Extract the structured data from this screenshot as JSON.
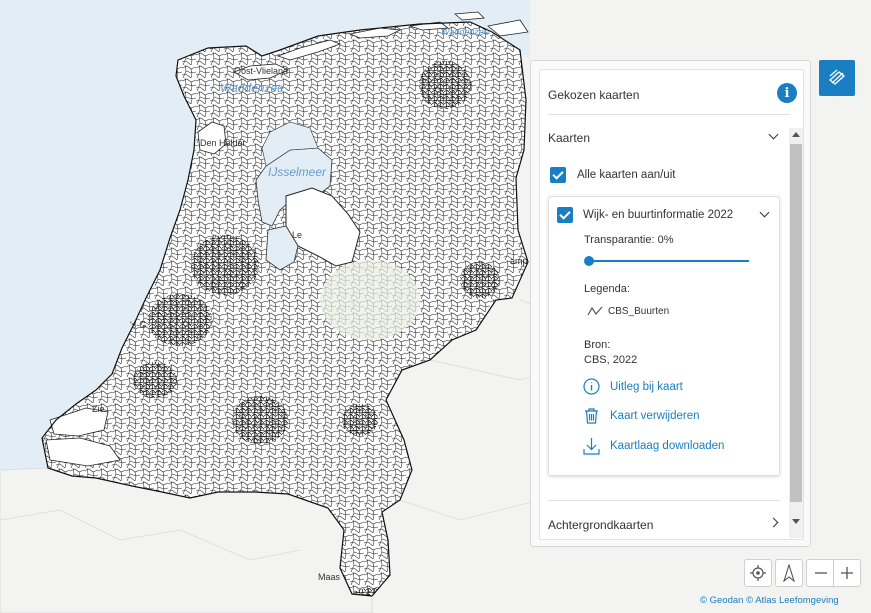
{
  "map": {
    "labels": {
      "waddenzee": "Waddenzee",
      "waddenzee_ne": "Waddenzee",
      "ijsselmeer": "IJsselmeer",
      "oost_vlieland": "Oost-Vlieland",
      "den_helder": "Den Helder",
      "lelystad": "Le",
      "s_gravenhage": "'s-G",
      "zierikzee": "Zie",
      "maastricht": "Maas",
      "coevorden": "amp"
    }
  },
  "panel": {
    "title": "Gekozen kaarten",
    "info_icon": "info-icon",
    "kaarten_section": "Kaarten",
    "toggle_all": "Alle kaarten aan/uit",
    "layer": {
      "name": "Wijk- en buurtinformatie 2022",
      "transparency": "Transparantie: 0%",
      "transparency_value": 0,
      "legend_title": "Legenda:",
      "legend_item": "CBS_Buurten",
      "source_title": "Bron:",
      "source_value": "CBS, 2022",
      "explain_link": "Uitleg bij kaart",
      "remove_link": "Kaart verwijderen",
      "download_link": "Kaartlaag downloaden"
    },
    "background_section": "Achtergrondkaarten"
  },
  "controls": {
    "locate": "locate-icon",
    "north": "north-arrow-icon",
    "zoom_out": "minus-icon",
    "zoom_in": "plus-icon"
  },
  "attribution": {
    "geodan": "© Geodan",
    "atlas": "© Atlas Leefomgeving"
  },
  "colors": {
    "accent": "#1a7ec2",
    "water": "#e2edf6",
    "land": "#f3f3f1"
  }
}
